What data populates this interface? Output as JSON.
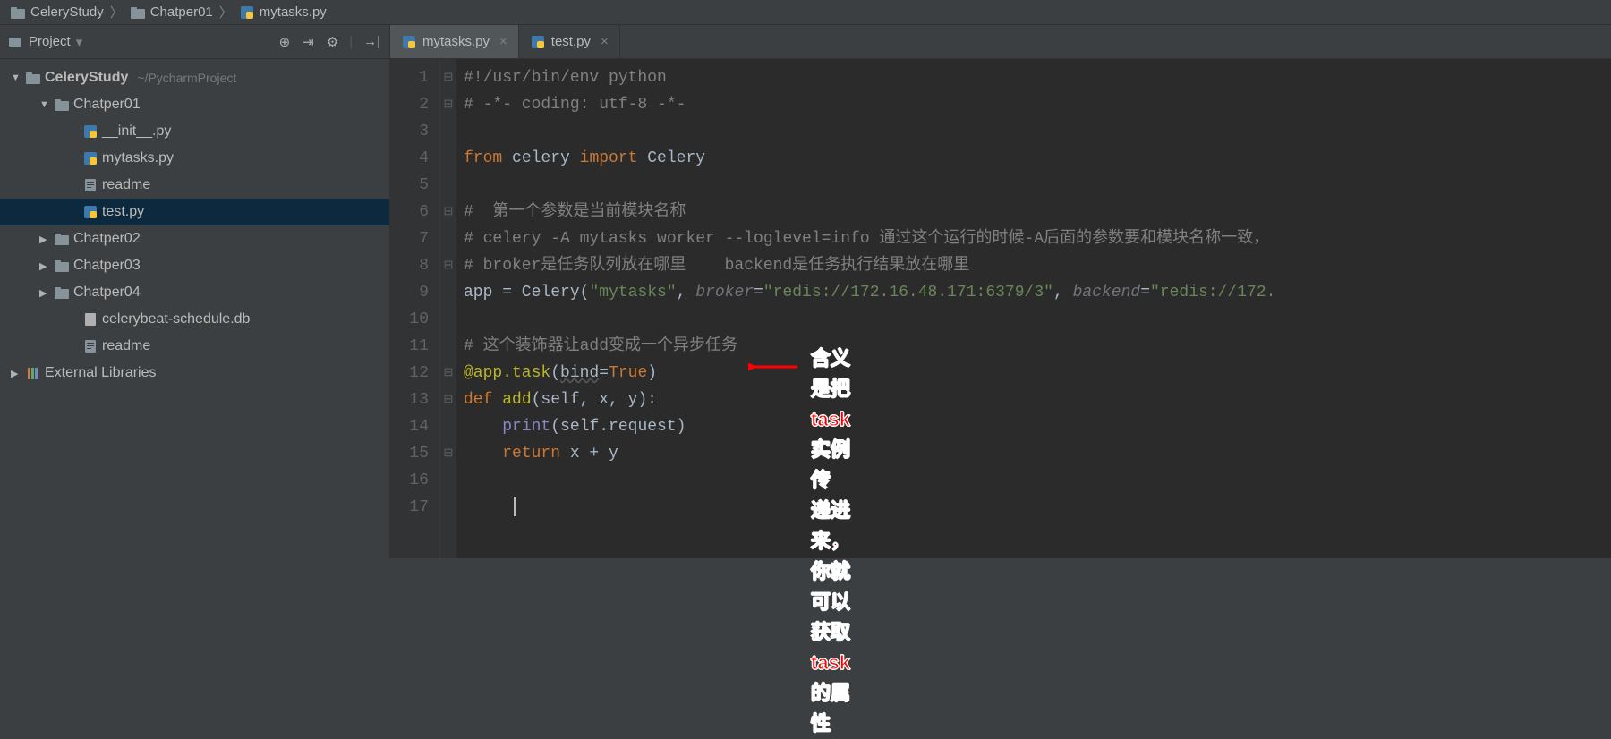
{
  "breadcrumb": {
    "items": [
      {
        "label": "CeleryStudy",
        "icon": "dir"
      },
      {
        "label": "Chatper01",
        "icon": "dir"
      },
      {
        "label": "mytasks.py",
        "icon": "py"
      }
    ]
  },
  "sidebar": {
    "header_label": "Project",
    "tree": [
      {
        "depth": 0,
        "arrow": "down",
        "icon": "dir",
        "name": "CeleryStudy",
        "bold": true,
        "hint": "~/PycharmProject"
      },
      {
        "depth": 1,
        "arrow": "down",
        "icon": "dir",
        "name": "Chatper01"
      },
      {
        "depth": 2,
        "arrow": "",
        "icon": "py",
        "name": "__init__.py"
      },
      {
        "depth": 2,
        "arrow": "",
        "icon": "py",
        "name": "mytasks.py"
      },
      {
        "depth": 2,
        "arrow": "",
        "icon": "txt",
        "name": "readme"
      },
      {
        "depth": 2,
        "arrow": "",
        "icon": "py",
        "name": "test.py",
        "selected": true
      },
      {
        "depth": 1,
        "arrow": "right",
        "icon": "dir",
        "name": "Chatper02"
      },
      {
        "depth": 1,
        "arrow": "right",
        "icon": "dir",
        "name": "Chatper03"
      },
      {
        "depth": 1,
        "arrow": "right",
        "icon": "dir",
        "name": "Chatper04"
      },
      {
        "depth": 2,
        "arrow": "",
        "icon": "file",
        "name": "celerybeat-schedule.db"
      },
      {
        "depth": 2,
        "arrow": "",
        "icon": "txt",
        "name": "readme"
      },
      {
        "depth": 0,
        "arrow": "right",
        "icon": "lib",
        "name": "External Libraries"
      }
    ]
  },
  "tabs": [
    {
      "label": "mytasks.py",
      "icon": "py",
      "active": true
    },
    {
      "label": "test.py",
      "icon": "py",
      "active": false
    }
  ],
  "code": {
    "lines": [
      {
        "n": 1,
        "fold": "⊟",
        "tokens": [
          {
            "c": "cmt",
            "t": "#!/usr/bin/env python"
          }
        ]
      },
      {
        "n": 2,
        "fold": "⊟",
        "tokens": [
          {
            "c": "cmt",
            "t": "# -*- coding: utf-8 -*-"
          }
        ]
      },
      {
        "n": 3,
        "tokens": []
      },
      {
        "n": 4,
        "tokens": [
          {
            "c": "kw",
            "t": "from"
          },
          {
            "t": " celery "
          },
          {
            "c": "kw",
            "t": "import"
          },
          {
            "t": " Celery"
          }
        ]
      },
      {
        "n": 5,
        "tokens": []
      },
      {
        "n": 6,
        "fold": "⊟",
        "tokens": [
          {
            "c": "cmt",
            "t": "#  第一个参数是当前模块名称"
          }
        ]
      },
      {
        "n": 7,
        "tokens": [
          {
            "c": "cmt",
            "t": "# celery -A mytasks worker --loglevel=info 通过这个运行的时候-A后面的参数要和模块名称一致，"
          }
        ]
      },
      {
        "n": 8,
        "fold": "⊟",
        "tokens": [
          {
            "c": "cmt",
            "t": "# broker是任务队列放在哪里    backend是任务执行结果放在哪里"
          }
        ]
      },
      {
        "n": 9,
        "tokens": [
          {
            "t": "app = Celery("
          },
          {
            "c": "str",
            "t": "\"mytasks\""
          },
          {
            "t": ", "
          },
          {
            "c": "param",
            "t": "broker"
          },
          {
            "t": "="
          },
          {
            "c": "str",
            "t": "\"redis://172.16.48.171:6379/3\""
          },
          {
            "t": ", "
          },
          {
            "c": "param",
            "t": "backend"
          },
          {
            "t": "="
          },
          {
            "c": "str",
            "t": "\"redis://172."
          }
        ]
      },
      {
        "n": 10,
        "tokens": []
      },
      {
        "n": 11,
        "tokens": [
          {
            "c": "cmt",
            "t": "# 这个装饰器让add变成一个异步任务"
          }
        ]
      },
      {
        "n": 12,
        "fold": "⊟",
        "tokens": [
          {
            "c": "dec",
            "t": "@app.task"
          },
          {
            "t": "("
          },
          {
            "c": "underl",
            "t": "bind"
          },
          {
            "t": "="
          },
          {
            "c": "kw",
            "t": "True"
          },
          {
            "t": ")"
          }
        ]
      },
      {
        "n": 13,
        "fold": "⊟",
        "tokens": [
          {
            "c": "kw",
            "t": "def "
          },
          {
            "c": "dec",
            "t": "add"
          },
          {
            "t": "(self, x, y):"
          }
        ]
      },
      {
        "n": 14,
        "indent": 1,
        "tokens": [
          {
            "c": "bi",
            "t": "print"
          },
          {
            "t": "(self.request)"
          }
        ]
      },
      {
        "n": 15,
        "fold": "⊟",
        "indent": 1,
        "tokens": [
          {
            "c": "kw",
            "t": "return"
          },
          {
            "t": " x + y"
          }
        ]
      },
      {
        "n": 16,
        "tokens": []
      },
      {
        "n": 17,
        "cursor": true,
        "tokens": []
      }
    ]
  },
  "annotation": {
    "line1": "含义是把task实例传",
    "line2": "递进来，你就可以获取",
    "line3": "task的属性"
  }
}
